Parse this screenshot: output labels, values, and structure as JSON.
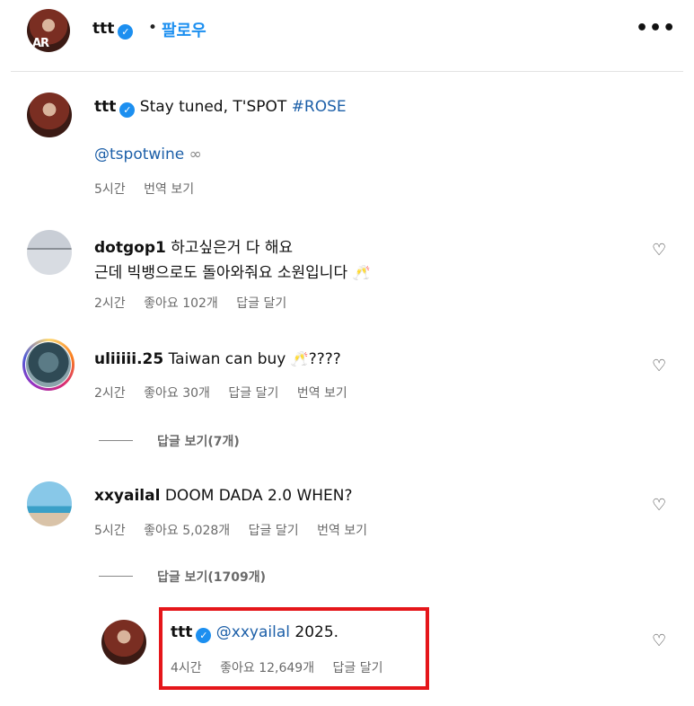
{
  "header": {
    "username": "ttt",
    "dot": "•",
    "follow": "팔로우",
    "more": "•••",
    "avatar_text": "AR"
  },
  "caption": {
    "username": "ttt",
    "text": "Stay tuned, T'SPOT",
    "hashtag": "#ROSE",
    "mention": "@tspotwine",
    "mention_icon": "∞",
    "time": "5시간",
    "translate": "번역 보기"
  },
  "comments": [
    {
      "username": "dotgop1",
      "line1": "하고싶은거 다 해요",
      "line2": "근데 빅뱅으로도 돌아와줘요 소원입니다",
      "emoji": "🥂",
      "time": "2시간",
      "likes": "좋아요 102개",
      "reply": "답글 달기"
    },
    {
      "username": "uliiiii.25",
      "text": "Taiwan can buy",
      "emoji": "🥂",
      "suffix": "????",
      "time": "2시간",
      "likes": "좋아요 30개",
      "reply": "답글 달기",
      "translate": "번역 보기",
      "view_replies": "답글 보기(7개)"
    },
    {
      "username": "xxyailal",
      "text": "DOOM DADA 2.0 WHEN?",
      "time": "5시간",
      "likes": "좋아요 5,028개",
      "reply": "답글 달기",
      "translate": "번역 보기",
      "view_replies": "답글 보기(1709개)"
    }
  ],
  "reply": {
    "username": "ttt",
    "mention": "@xxyailal",
    "text": "2025.",
    "time": "4시간",
    "likes": "좋아요 12,649개",
    "reply": "답글 달기"
  },
  "icons": {
    "heart": "♡",
    "verified": "✓"
  },
  "colors": {
    "accent": "#1c8ff0",
    "highlight": "#e5161a",
    "link": "#1c5fa8"
  }
}
